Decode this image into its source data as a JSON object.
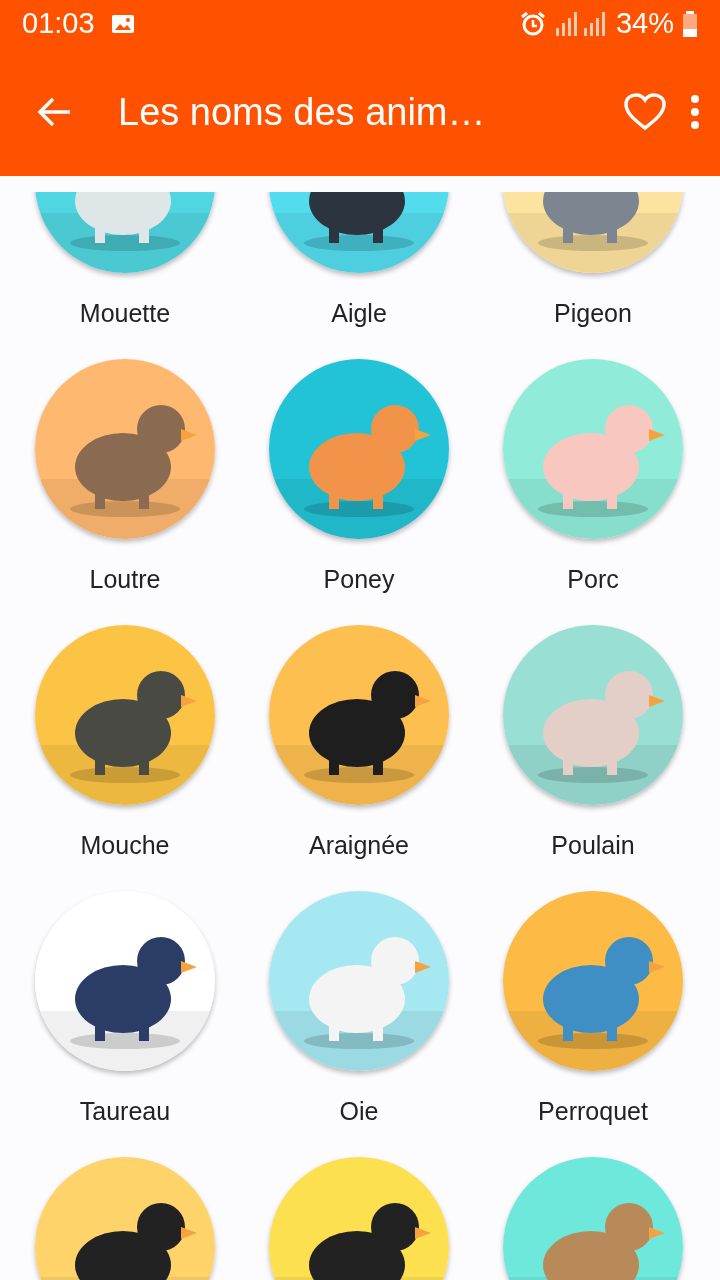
{
  "status_bar": {
    "time": "01:03",
    "battery": "34%"
  },
  "app_bar": {
    "title": "Les noms des anim…"
  },
  "animals": [
    {
      "kind": "picture",
      "name": "Mouette"
    },
    {
      "kind": "picture",
      "name": "Aigle"
    },
    {
      "kind": "picture",
      "name": "Pigeon"
    },
    {
      "kind": "picture",
      "name": "Loutre"
    },
    {
      "kind": "picture",
      "name": "Poney"
    },
    {
      "kind": "picture",
      "name": "Porc"
    },
    {
      "kind": "picture",
      "name": "Mouche"
    },
    {
      "kind": "picture",
      "name": "Araignée"
    },
    {
      "kind": "picture",
      "name": "Poulain"
    },
    {
      "kind": "picture",
      "name": "Taureau"
    },
    {
      "kind": "picture",
      "name": "Oie"
    },
    {
      "kind": "picture",
      "name": "Perroquet"
    },
    {
      "kind": "picture"
    },
    {
      "kind": "picture"
    },
    {
      "kind": "picture"
    }
  ]
}
